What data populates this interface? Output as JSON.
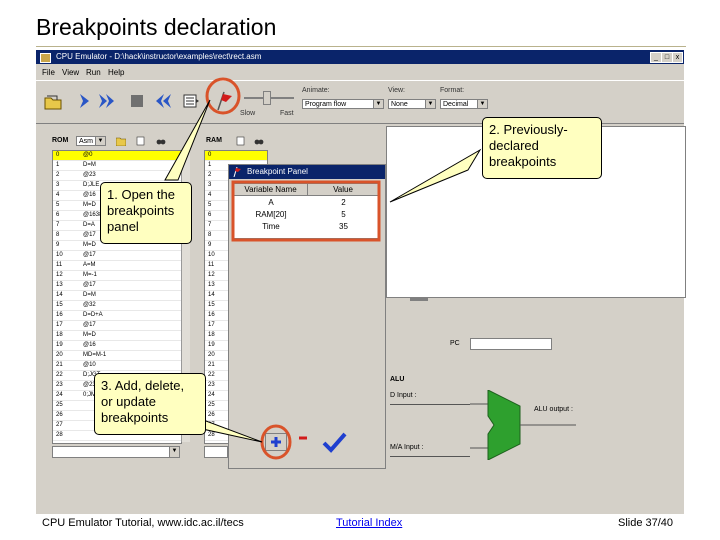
{
  "slide": {
    "title": "Breakpoints declaration",
    "footer_left": "CPU Emulator Tutorial, www.idc.ac.il/tecs",
    "footer_link": "Tutorial Index",
    "footer_right": "Slide 37/40"
  },
  "window": {
    "title": "CPU Emulator - D:\\hack\\instructor\\examples\\rect\\rect.asm",
    "menu": [
      "File",
      "View",
      "Run",
      "Help"
    ]
  },
  "toolbar": {
    "slow_label": "Slow",
    "fast_label": "Fast",
    "animate_label": "Animate:",
    "animate_value": "Program flow",
    "view_label": "View:",
    "view_value": "None",
    "format_label": "Format:",
    "format_value": "Decimal"
  },
  "rom": {
    "title": "ROM",
    "format_value": "Asm",
    "rows": [
      [
        "0",
        "@0"
      ],
      [
        "1",
        "D=M"
      ],
      [
        "2",
        "@23"
      ],
      [
        "3",
        "D;JLE"
      ],
      [
        "4",
        "@16"
      ],
      [
        "5",
        "M=D"
      ],
      [
        "6",
        "@16384"
      ],
      [
        "7",
        "D=A"
      ],
      [
        "8",
        "@17"
      ],
      [
        "9",
        "M=D"
      ],
      [
        "10",
        "@17"
      ],
      [
        "11",
        "A=M"
      ],
      [
        "12",
        "M=-1"
      ],
      [
        "13",
        "@17"
      ],
      [
        "14",
        "D=M"
      ],
      [
        "15",
        "@32"
      ],
      [
        "16",
        "D=D+A"
      ],
      [
        "17",
        "@17"
      ],
      [
        "18",
        "M=D"
      ],
      [
        "19",
        "@16"
      ],
      [
        "20",
        "MD=M-1"
      ],
      [
        "21",
        "@10"
      ],
      [
        "22",
        "D;JGT"
      ],
      [
        "23",
        "@23"
      ],
      [
        "24",
        "0;JMP"
      ],
      [
        "25",
        ""
      ],
      [
        "26",
        ""
      ],
      [
        "27",
        ""
      ],
      [
        "28",
        ""
      ]
    ]
  },
  "ram": {
    "title": "RAM",
    "rows": [
      "0",
      "1",
      "2",
      "3",
      "4",
      "5",
      "6",
      "7",
      "8",
      "9",
      "10",
      "11",
      "12",
      "13",
      "14",
      "15",
      "16",
      "17",
      "18",
      "19",
      "20",
      "21",
      "22",
      "23",
      "24",
      "25",
      "26",
      "27",
      "28"
    ]
  },
  "breakpoint_panel": {
    "title": "Breakpoint Panel",
    "col_name": "Variable Name",
    "col_value": "Value",
    "rows": [
      [
        "A",
        "2"
      ],
      [
        "RAM[20]",
        "5"
      ],
      [
        "Time",
        "35"
      ]
    ]
  },
  "alu": {
    "title": "ALU",
    "d_input": "D Input :",
    "m_input": "M/A Input :",
    "output": "ALU output :"
  },
  "screen_labels": {
    "pc_label": "PC"
  },
  "callouts": {
    "c1": "1. Open the breakpoints panel",
    "c2": "2. Previously-declared breakpoints",
    "c3": "3. Add, delete, or update breakpoints"
  },
  "colors": {
    "highlight": "#d9532a",
    "selected_row": "#ffff00",
    "callout": "#ffffc0"
  }
}
